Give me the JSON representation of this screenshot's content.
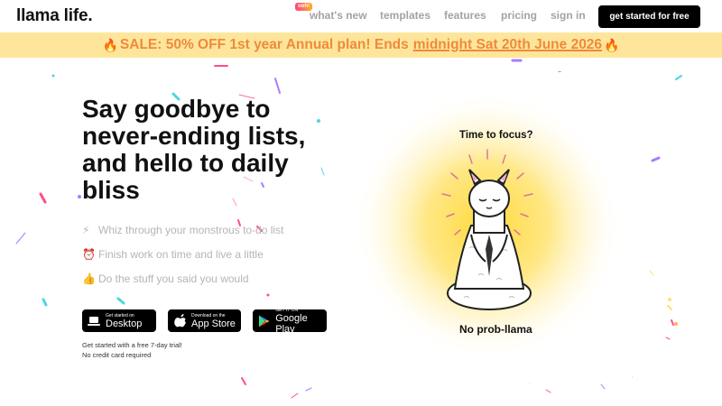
{
  "header": {
    "logo": "llama life.",
    "badge": "ooh!",
    "nav": {
      "whats_new": "what's new",
      "templates": "templates",
      "features": "features",
      "pricing": "pricing",
      "sign_in": "sign in"
    },
    "cta": "get started for free"
  },
  "banner": {
    "fire": "🔥",
    "text": "SALE: 50% OFF 1st year Annual plan! Ends",
    "link": "midnight Sat 20th June 2026"
  },
  "hero": {
    "title": "Say goodbye to never-ending lists, and hello to daily bliss",
    "benefits": [
      {
        "icon": "⚡",
        "icon_name": "lightning-icon",
        "text": "Whiz through your monstrous to-do list"
      },
      {
        "icon": "⏰",
        "icon_name": "alarm-clock-icon",
        "text": "Finish work on time and live a little"
      },
      {
        "icon": "👍",
        "icon_name": "thumbs-up-icon",
        "text": "Do the stuff you said you would"
      }
    ],
    "stores": {
      "desktop": {
        "small": "Get started on",
        "big": "Desktop"
      },
      "appstore": {
        "small": "Download on the",
        "big": "App Store"
      },
      "play": {
        "small": "GET IT ON",
        "big": "Google Play"
      }
    },
    "trial_line1": "Get started with a free 7-day trial!",
    "trial_line2": "No credit card required"
  },
  "illustration": {
    "top_text": "Time to focus?",
    "bottom_text": "No prob-llama"
  },
  "colors": {
    "banner_bg": "#fde69c",
    "banner_text": "#f08a3b",
    "cta_bg": "#000000",
    "glow": "#ffd83a"
  }
}
